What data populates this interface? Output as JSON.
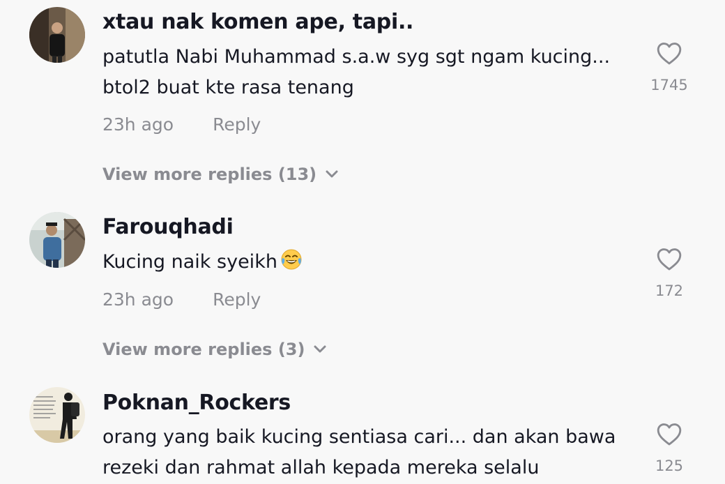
{
  "comments": [
    {
      "username": "xtau nak komen ape, tapi..",
      "text_line1": "patutla Nabi Muhammad s.a.w syg sgt ngam kucing...",
      "text_line2": "btol2 buat kte rasa tenang",
      "time": "23h ago",
      "reply_label": "Reply",
      "view_more": "View more replies (13)",
      "likes": "1745"
    },
    {
      "username": "Farouqhadi",
      "text": "Kucing naik syeikh",
      "emoji": "face-with-tears-of-joy",
      "time": "23h ago",
      "reply_label": "Reply",
      "view_more": "View more replies (3)",
      "likes": "172"
    },
    {
      "username": "Poknan_Rockers",
      "text_line1": "orang yang baik kucing sentiasa cari... dan akan bawa",
      "text_line2": "rezeki dan rahmat allah kepada mereka selalu",
      "likes": "125"
    }
  ],
  "colors": {
    "background": "#f8f8f8",
    "primary_text": "#161823",
    "secondary_text": "#8a8b91"
  },
  "icons": [
    "heart-outline-icon",
    "chevron-down-icon"
  ]
}
